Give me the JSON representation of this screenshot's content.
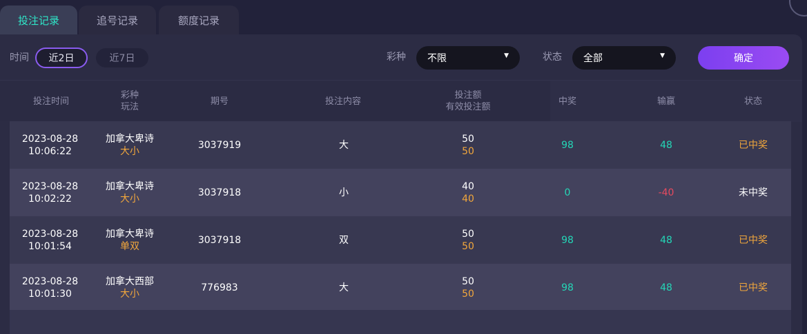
{
  "tabs": [
    {
      "label": "投注记录",
      "active": true
    },
    {
      "label": "追号记录",
      "active": false
    },
    {
      "label": "额度记录",
      "active": false
    }
  ],
  "filters": {
    "time_label": "时间",
    "time_options": [
      "近2日",
      "近7日"
    ],
    "time_selected": "近2日",
    "lottery_label": "彩种",
    "lottery_value": "不限",
    "status_label": "状态",
    "status_value": "全部",
    "confirm_label": "确定"
  },
  "table": {
    "headers": {
      "bet_time": "投注时间",
      "lottery_line1": "彩种",
      "lottery_line2": "玩法",
      "issue": "期号",
      "content": "投注内容",
      "amount_line1": "投注额",
      "amount_line2": "有效投注额",
      "prize": "中奖",
      "win_loss": "输赢",
      "status": "状态"
    },
    "rows": [
      {
        "date": "2023-08-28",
        "time": "10:06:22",
        "lottery": "加拿大卑诗",
        "play": "大小",
        "issue": "3037919",
        "content": "大",
        "amount": "50",
        "valid_amount": "50",
        "prize": "98",
        "win_loss": "48",
        "status": "已中奖",
        "win_loss_color": "#24d7b7",
        "status_color": "#f2a73c"
      },
      {
        "date": "2023-08-28",
        "time": "10:02:22",
        "lottery": "加拿大卑诗",
        "play": "大小",
        "issue": "3037918",
        "content": "小",
        "amount": "40",
        "valid_amount": "40",
        "prize": "0",
        "win_loss": "-40",
        "status": "未中奖",
        "win_loss_color": "#e84a5f",
        "status_color": "#ffffff"
      },
      {
        "date": "2023-08-28",
        "time": "10:01:54",
        "lottery": "加拿大卑诗",
        "play": "单双",
        "issue": "3037918",
        "content": "双",
        "amount": "50",
        "valid_amount": "50",
        "prize": "98",
        "win_loss": "48",
        "status": "已中奖",
        "win_loss_color": "#24d7b7",
        "status_color": "#f2a73c"
      },
      {
        "date": "2023-08-28",
        "time": "10:01:30",
        "lottery": "加拿大西部",
        "play": "大小",
        "issue": "776983",
        "content": "大",
        "amount": "50",
        "valid_amount": "50",
        "prize": "98",
        "win_loss": "48",
        "status": "已中奖",
        "win_loss_color": "#24d7b7",
        "status_color": "#f2a73c"
      }
    ]
  },
  "colors": {
    "accent_teal": "#2fe6c8",
    "accent_purple": "#8a5cf0",
    "prize_teal": "#24d7b7",
    "loss_red": "#e84a5f",
    "win_orange": "#f2a73c"
  }
}
